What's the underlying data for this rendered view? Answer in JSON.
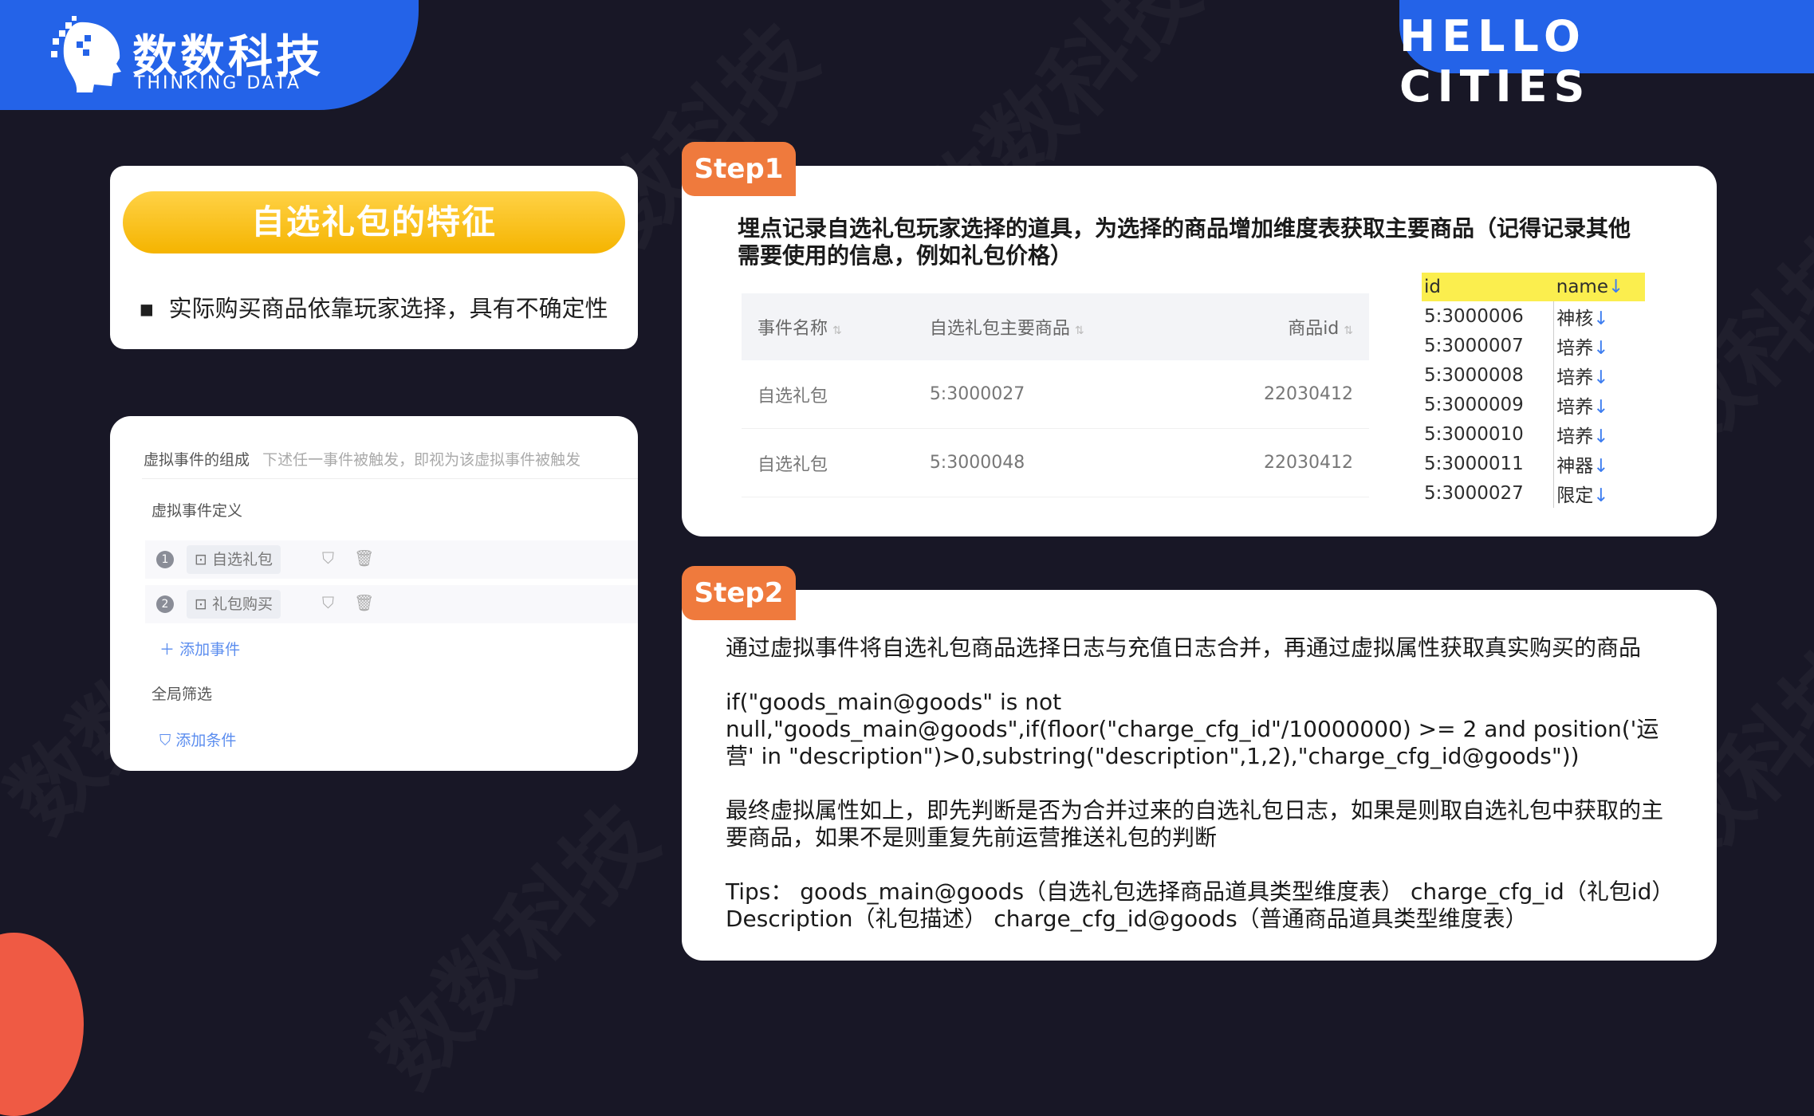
{
  "brand": {
    "name_cn": "数数科技",
    "name_en": "THINKING DATA",
    "slogan": "HELLO CITIES",
    "accent": "#2463e8",
    "watermark": "数数科技"
  },
  "feature": {
    "title": "自选礼包的特征",
    "bullet": "实际购买商品依靠玩家选择，具有不确定性"
  },
  "virtual_event": {
    "header": "虚拟事件的组成",
    "hint": "下述任一事件被触发，即视为该虚拟事件被触发",
    "definition_label": "虚拟事件定义",
    "events": [
      {
        "index": "1",
        "name": "自选礼包"
      },
      {
        "index": "2",
        "name": "礼包购买"
      }
    ],
    "add_event": "添加事件",
    "global_filter": "全局筛选",
    "add_condition": "添加条件"
  },
  "step1": {
    "tag": "Step1",
    "description": "埋点记录自选礼包玩家选择的道具，为选择的商品增加维度表获取主要商品（记得记录其他需要使用的信息，例如礼包价格）",
    "event_table": {
      "headers": [
        "事件名称",
        "自选礼包主要商品",
        "商品id"
      ],
      "rows": [
        [
          "自选礼包",
          "5:3000027",
          "22030412"
        ],
        [
          "自选礼包",
          "5:3000048",
          "22030412"
        ]
      ]
    },
    "id_table": {
      "headers": [
        "id",
        "name"
      ],
      "rows": [
        [
          "5:3000006",
          "神核"
        ],
        [
          "5:3000007",
          "培养"
        ],
        [
          "5:3000008",
          "培养"
        ],
        [
          "5:3000009",
          "培养"
        ],
        [
          "5:3000010",
          "培养"
        ],
        [
          "5:3000011",
          "神器"
        ],
        [
          "5:3000027",
          "限定"
        ]
      ]
    }
  },
  "step2": {
    "tag": "Step2",
    "p1": "通过虚拟事件将自选礼包商品选择日志与充值日志合并，再通过虚拟属性获取真实购买的商品",
    "p2": "if(\"goods_main@goods\" is not null,\"goods_main@goods\",if(floor(\"charge_cfg_id\"/10000000) >= 2 and position('运营' in \"description\")>0,substring(\"description\",1,2),\"charge_cfg_id@goods\"))",
    "p3": "最终虚拟属性如上，即先判断是否为合并过来的自选礼包日志，如果是则取自选礼包中获取的主要商品，如果不是则重复先前运营推送礼包的判断",
    "p4": "Tips： goods_main@goods（自选礼包选择商品道具类型维度表）  charge_cfg_id（礼包id） Description（礼包描述） charge_cfg_id@goods（普通商品道具类型维度表）"
  }
}
